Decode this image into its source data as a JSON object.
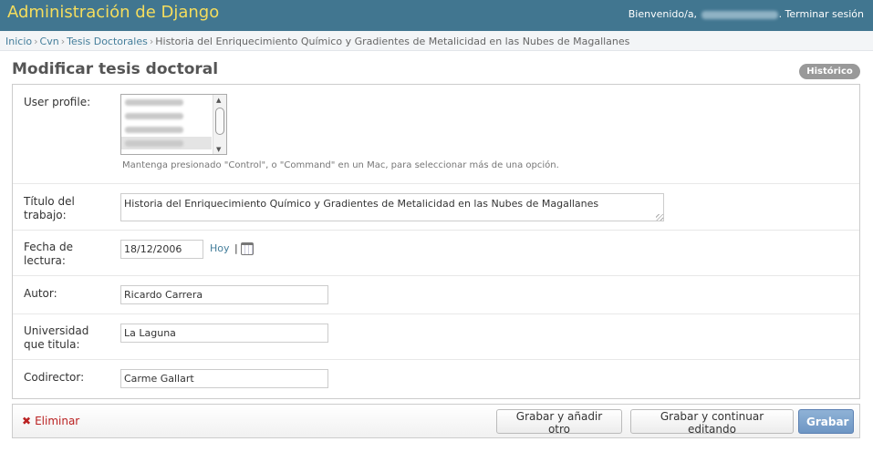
{
  "header": {
    "branding": "Administración de Django",
    "welcome_prefix": "Bienvenido/a,",
    "logout_label": ". Terminar sesión"
  },
  "breadcrumbs": {
    "items": [
      "Inicio",
      "Cvn",
      "Tesis Doctorales"
    ],
    "current": "Historia del Enriquecimiento Químico y Gradientes de Metalicidad en las Nubes de Magallanes"
  },
  "page": {
    "title": "Modificar tesis doctoral",
    "history_label": "Histórico"
  },
  "form": {
    "user_profile": {
      "label": "User profile:",
      "help": "Mantenga presionado \"Control\", o \"Command\" en un Mac, para seleccionar más de una opción."
    },
    "titulo": {
      "label_line1": "Título del",
      "label_line2": "trabajo:",
      "value": "Historia del Enriquecimiento Químico y Gradientes de Metalicidad en las Nubes de Magallanes"
    },
    "fecha": {
      "label_line1": "Fecha de",
      "label_line2": "lectura:",
      "value": "18/12/2006",
      "today_label": "Hoy",
      "separator": "|"
    },
    "autor": {
      "label": "Autor:",
      "value": "Ricardo Carrera"
    },
    "universidad": {
      "label_line1": "Universidad",
      "label_line2": "que titula:",
      "value": "La Laguna"
    },
    "codirector": {
      "label": "Codirector:",
      "value": "Carme Gallart"
    }
  },
  "submit": {
    "delete_icon": "✖",
    "delete_label": "Eliminar",
    "save_add_label": "Grabar y añadir otro",
    "save_continue_label": "Grabar y continuar editando",
    "save_label": "Grabar"
  },
  "colors": {
    "header_bg": "#417690",
    "branding": "#f5dd5d",
    "link": "#447e9b",
    "delete": "#ba2121",
    "save_button": "#6e96c4"
  }
}
